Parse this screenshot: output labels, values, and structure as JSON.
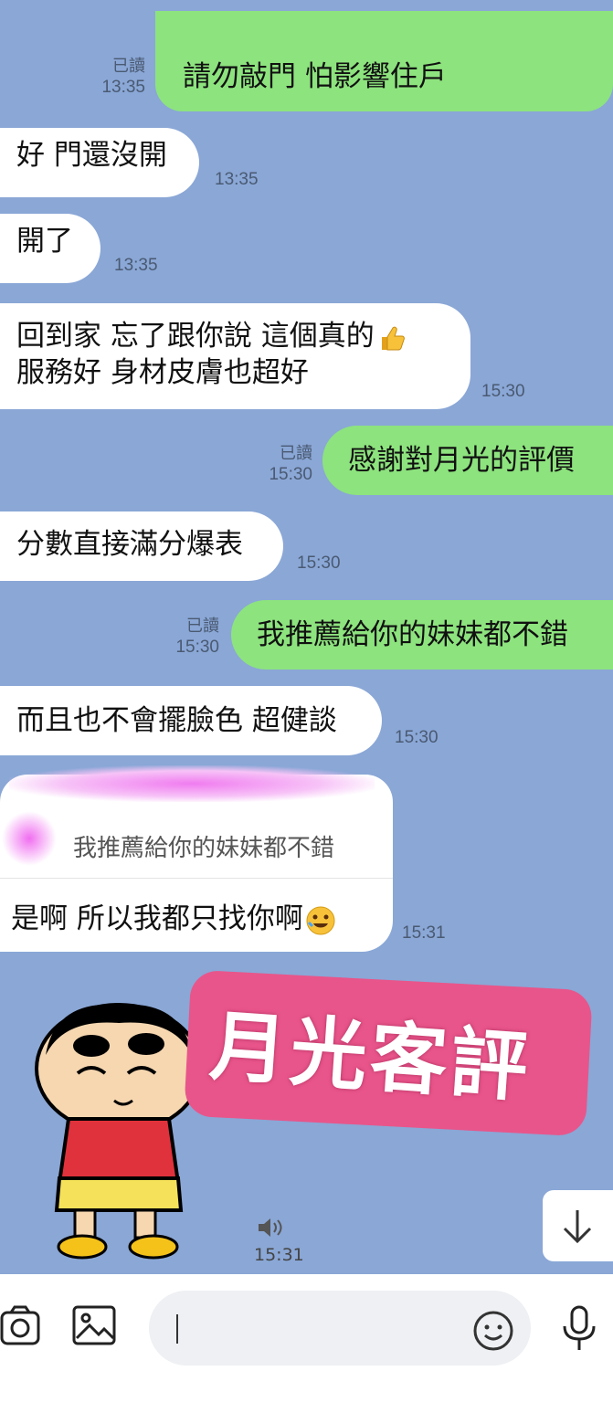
{
  "messages": [
    {
      "side": "out",
      "text": "請勿敲門 怕影響住戶",
      "read": "已讀",
      "time": "13:35"
    },
    {
      "side": "in",
      "text": "好 門還沒開",
      "time": "13:35"
    },
    {
      "side": "in",
      "text": "開了",
      "time": "13:35"
    },
    {
      "side": "in",
      "line1": "回到家 忘了跟你說 這個真的",
      "line2": "服務好 身材皮膚也超好",
      "time": "15:30",
      "emoji": "thumbs-up-emoji"
    },
    {
      "side": "out",
      "text": "感謝對月光的評價",
      "read": "已讀",
      "time": "15:30"
    },
    {
      "side": "in",
      "text": "分數直接滿分爆表",
      "time": "15:30"
    },
    {
      "side": "out",
      "text": "我推薦給你的妹妹都不錯",
      "read": "已讀",
      "time": "15:30"
    },
    {
      "side": "in",
      "text": "而且也不會擺臉色 超健談",
      "time": "15:30"
    },
    {
      "side": "in",
      "reply_quote": "我推薦給你的妹妹都不錯",
      "text": "是啊 所以我都只找你啊",
      "time": "15:31",
      "emoji": "rofl-emoji"
    }
  ],
  "voice": {
    "time": "15:31",
    "icon": "speaker-icon"
  },
  "badge": {
    "text": "月光客評"
  },
  "colors": {
    "background": "#8aa7d6",
    "outgoing": "#8de37e",
    "incoming": "#ffffff",
    "badge": "#e8558a"
  },
  "input": {
    "placeholder": ""
  },
  "icons": [
    "camera-icon",
    "image-icon",
    "emoji-icon",
    "mic-icon",
    "arrow-down-icon"
  ]
}
